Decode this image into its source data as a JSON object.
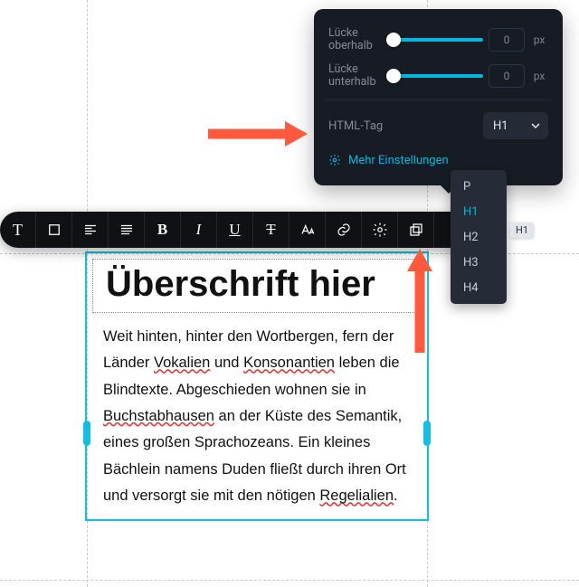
{
  "panel": {
    "gap_above": {
      "label": "Lücke oberhalb",
      "value": "0",
      "unit": "px"
    },
    "gap_below": {
      "label": "Lücke unterhalb",
      "value": "0",
      "unit": "px"
    },
    "html_tag": {
      "label": "HTML-Tag",
      "selected": "H1"
    },
    "more": "Mehr Einstellungen"
  },
  "dropdown": {
    "items": [
      "P",
      "H1",
      "H2",
      "H3",
      "H4"
    ],
    "selected": "H1"
  },
  "tooltip": "H1",
  "toolbar": {
    "items": [
      "text-type",
      "box",
      "align-left",
      "align-justify",
      "bold",
      "italic",
      "underline",
      "strikethrough",
      "text-size",
      "link",
      "settings",
      "layers"
    ]
  },
  "content": {
    "heading": "Überschrift hier",
    "body": {
      "p1a": "Weit hinten, hinter den Wortbergen, fern der Länder ",
      "w1": "Vokalien",
      "p1b": " und ",
      "w2": "Konsonantien",
      "p1c": " leben die Blindtexte. Abgeschieden wohnen sie in ",
      "w3": "Buchstabhausen",
      "p1d": " an der Küste des Semantik, eines großen Sprachozeans. Ein kleines Bächlein namens Duden fließt durch ihren Ort und versorgt sie mit den nötigen ",
      "w4": "Regelialien",
      "p1e": "."
    }
  }
}
